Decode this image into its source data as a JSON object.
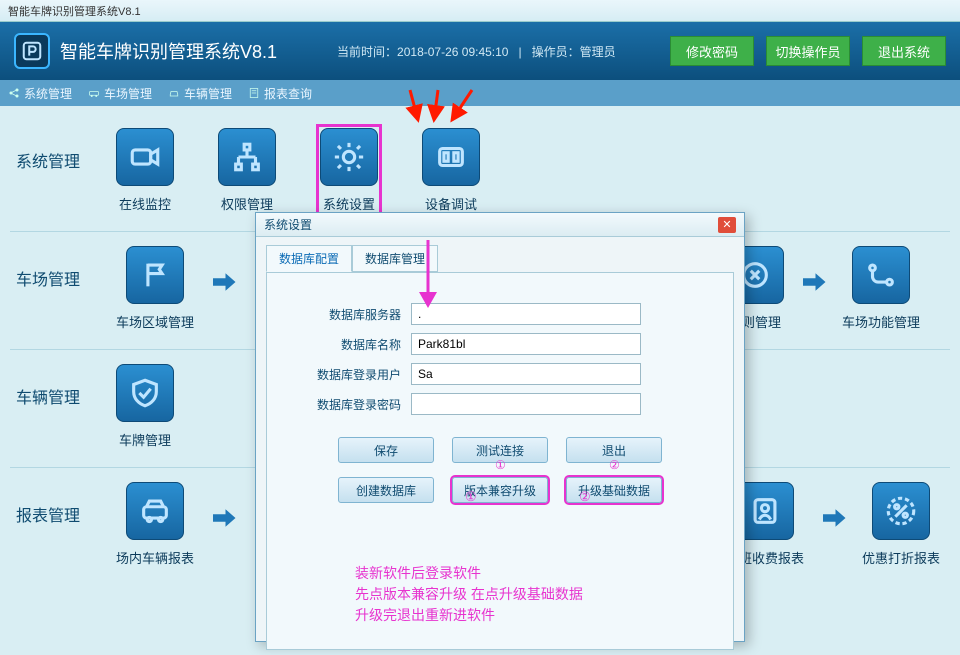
{
  "window": {
    "title": "智能车牌识别管理系统V8.1"
  },
  "header": {
    "app_title": "智能车牌识别管理系统V8.1",
    "time_label": "当前时间：",
    "time_value": "2018-07-26 09:45:10",
    "operator_label": "操作员：",
    "operator_value": "管理员",
    "btn_password": "修改密码",
    "btn_switch": "切换操作员",
    "btn_exit": "退出系统"
  },
  "nav": {
    "items": [
      {
        "label": "系统管理"
      },
      {
        "label": "车场管理"
      },
      {
        "label": "车辆管理"
      },
      {
        "label": "报表查询"
      }
    ]
  },
  "sections": {
    "system": {
      "label": "系统管理",
      "tiles": [
        {
          "label": "在线监控"
        },
        {
          "label": "权限管理"
        },
        {
          "label": "系统设置"
        },
        {
          "label": "设备调试"
        }
      ]
    },
    "park": {
      "label": "车场管理",
      "tiles": [
        {
          "label": "车场区域管理"
        },
        {
          "label": "规则管理"
        },
        {
          "label": "车场功能管理"
        }
      ]
    },
    "vehicle": {
      "label": "车辆管理",
      "tiles": [
        {
          "label": "车牌管理"
        }
      ]
    },
    "report": {
      "label": "报表管理",
      "tiles": [
        {
          "label": "场内车辆报表"
        },
        {
          "label": "值班收费报表"
        },
        {
          "label": "优惠打折报表"
        }
      ]
    }
  },
  "dialog": {
    "title": "系统设置",
    "tabs": {
      "config": "数据库配置",
      "manage": "数据库管理"
    },
    "fields": {
      "server_label": "数据库服务器",
      "server_value": ".",
      "name_label": "数据库名称",
      "name_value": "Park81bl",
      "user_label": "数据库登录用户",
      "user_value": "Sa",
      "pwd_label": "数据库登录密码",
      "pwd_value": ""
    },
    "buttons": {
      "save": "保存",
      "test": "测试连接",
      "exit": "退出",
      "create": "创建数据库",
      "compat": "版本兼容升级",
      "basedata": "升级基础数据"
    },
    "markers": {
      "one": "①",
      "two": "②"
    },
    "note_line1": "装新软件后登录软件",
    "note_line2": "先点版本兼容升级 在点升级基础数据",
    "note_line3": "升级完退出重新进软件"
  }
}
